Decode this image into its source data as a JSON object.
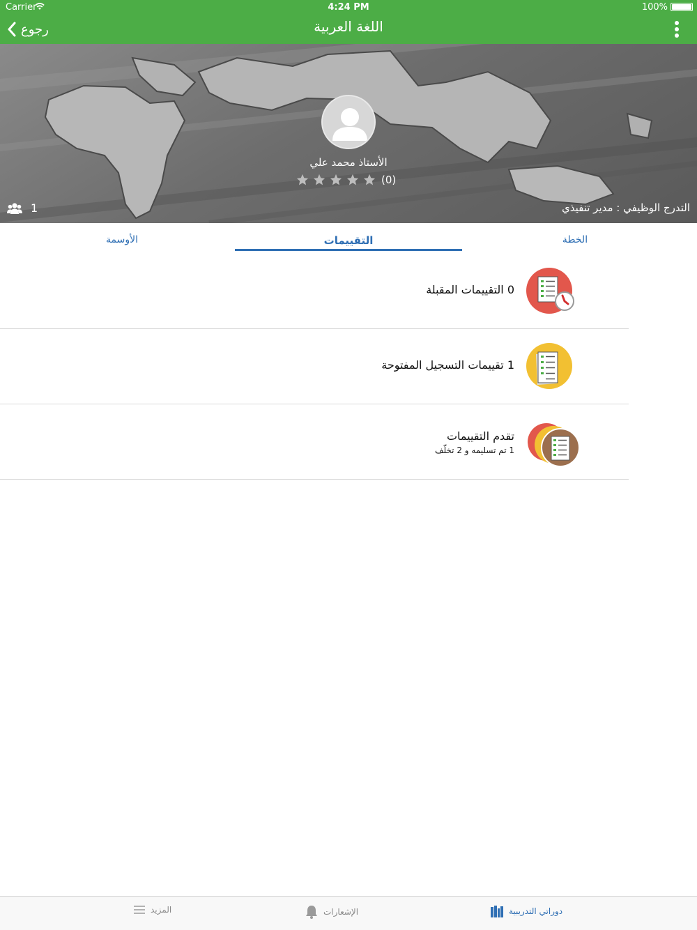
{
  "status_bar": {
    "carrier": "Carrier",
    "time": "4:24 PM",
    "battery": "100%"
  },
  "nav": {
    "back_label": "رجوع",
    "title": "اللغة العربية"
  },
  "profile": {
    "teacher_name": "الأستاذ محمد علي",
    "rating_count": "(0)",
    "stars_filled": 0,
    "stars_total": 5,
    "members_count": "1",
    "career_level": "التدرج الوظيفي : مدير تنفيذي"
  },
  "tabs": {
    "plan": "الخطة",
    "evaluations": "التقييمات",
    "badges": "الأوسمة",
    "active": "evaluations"
  },
  "evaluations": [
    {
      "label": "0 التقييمات المقبلة",
      "icon": "upcoming-evaluations-icon"
    },
    {
      "label": "1 تقييمات التسجيل المفتوحة",
      "icon": "open-registration-evaluations-icon"
    },
    {
      "label": "تقدم التقييمات",
      "sublabel": "1 تم تسليمه و 2 تخلّف",
      "icon": "evaluations-progress-icon"
    }
  ],
  "bottom_tabs": {
    "courses": "دوراتي التدريبية",
    "notifications": "الإشعارات",
    "more": "المزيد",
    "active": "courses"
  },
  "colors": {
    "header_green": "#4cad46",
    "accent_blue": "#2f6fb4",
    "upcoming_red": "#e2574c",
    "open_yellow": "#f2c032",
    "progress_brown": "#9c6f4e"
  }
}
